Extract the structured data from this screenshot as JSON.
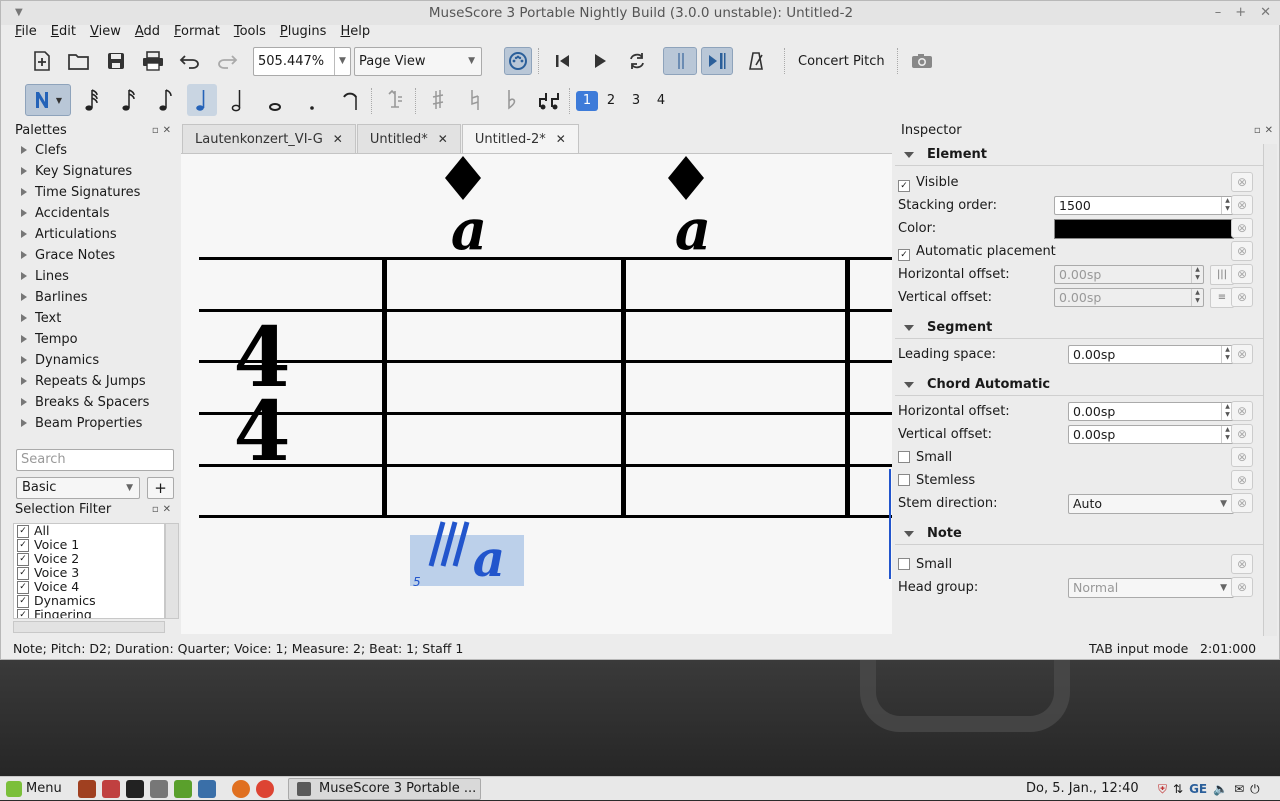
{
  "window": {
    "title": "MuseScore 3 Portable Nightly Build (3.0.0 unstable): Untitled-2"
  },
  "menubar": [
    "File",
    "Edit",
    "View",
    "Add",
    "Format",
    "Tools",
    "Plugins",
    "Help"
  ],
  "toolbar": {
    "zoom": "505.447%",
    "view_mode": "Page View",
    "concert_pitch": "Concert Pitch"
  },
  "voices": [
    "1",
    "2",
    "3",
    "4"
  ],
  "palettes": {
    "title": "Palettes",
    "items": [
      "Clefs",
      "Key Signatures",
      "Time Signatures",
      "Accidentals",
      "Articulations",
      "Grace Notes",
      "Lines",
      "Barlines",
      "Text",
      "Tempo",
      "Dynamics",
      "Repeats & Jumps",
      "Breaks & Spacers",
      "Beam Properties"
    ],
    "search_placeholder": "Search",
    "workspace": "Basic",
    "add": "+"
  },
  "selection_filter": {
    "title": "Selection Filter",
    "items": [
      "All",
      "Voice 1",
      "Voice 2",
      "Voice 3",
      "Voice 4",
      "Dynamics",
      "Fingering"
    ]
  },
  "tabs": [
    "Lautenkonzert_VI-G",
    "Untitled*",
    "Untitled-2*"
  ],
  "score": {
    "time_sig_top": "4",
    "time_sig_bottom": "4",
    "note_letter_1": "a",
    "note_letter_2": "a",
    "selected_letter": "a",
    "fret_mark": "5"
  },
  "inspector": {
    "title": "Inspector",
    "element": {
      "title": "Element",
      "visible": "Visible",
      "stacking_label": "Stacking order:",
      "stacking_value": "1500",
      "color_label": "Color:",
      "color_value": "#000000",
      "auto_place": "Automatic placement",
      "hoff_label": "Horizontal offset:",
      "hoff_value": "0.00sp",
      "voff_label": "Vertical offset:",
      "voff_value": "0.00sp"
    },
    "segment": {
      "title": "Segment",
      "leading_label": "Leading space:",
      "leading_value": "0.00sp"
    },
    "chord": {
      "title": "Chord Automatic",
      "hoff_label": "Horizontal offset:",
      "hoff_value": "0.00sp",
      "voff_label": "Vertical offset:",
      "voff_value": "0.00sp",
      "small": "Small",
      "stemless": "Stemless",
      "stem_label": "Stem direction:",
      "stem_value": "Auto"
    },
    "note": {
      "title": "Note",
      "small": "Small",
      "head_label": "Head group:",
      "head_value": "Normal"
    }
  },
  "status": {
    "left": "Note; Pitch: D2; Duration: Quarter; Voice: 1;  Measure: 2; Beat: 1; Staff 1",
    "mode": "TAB input mode",
    "time": "2:01:000"
  },
  "taskbar": {
    "menu": "Menu",
    "app": "MuseScore 3 Portable ...",
    "clock": "Do,  5. Jan., 12:40",
    "lang": "GE"
  }
}
